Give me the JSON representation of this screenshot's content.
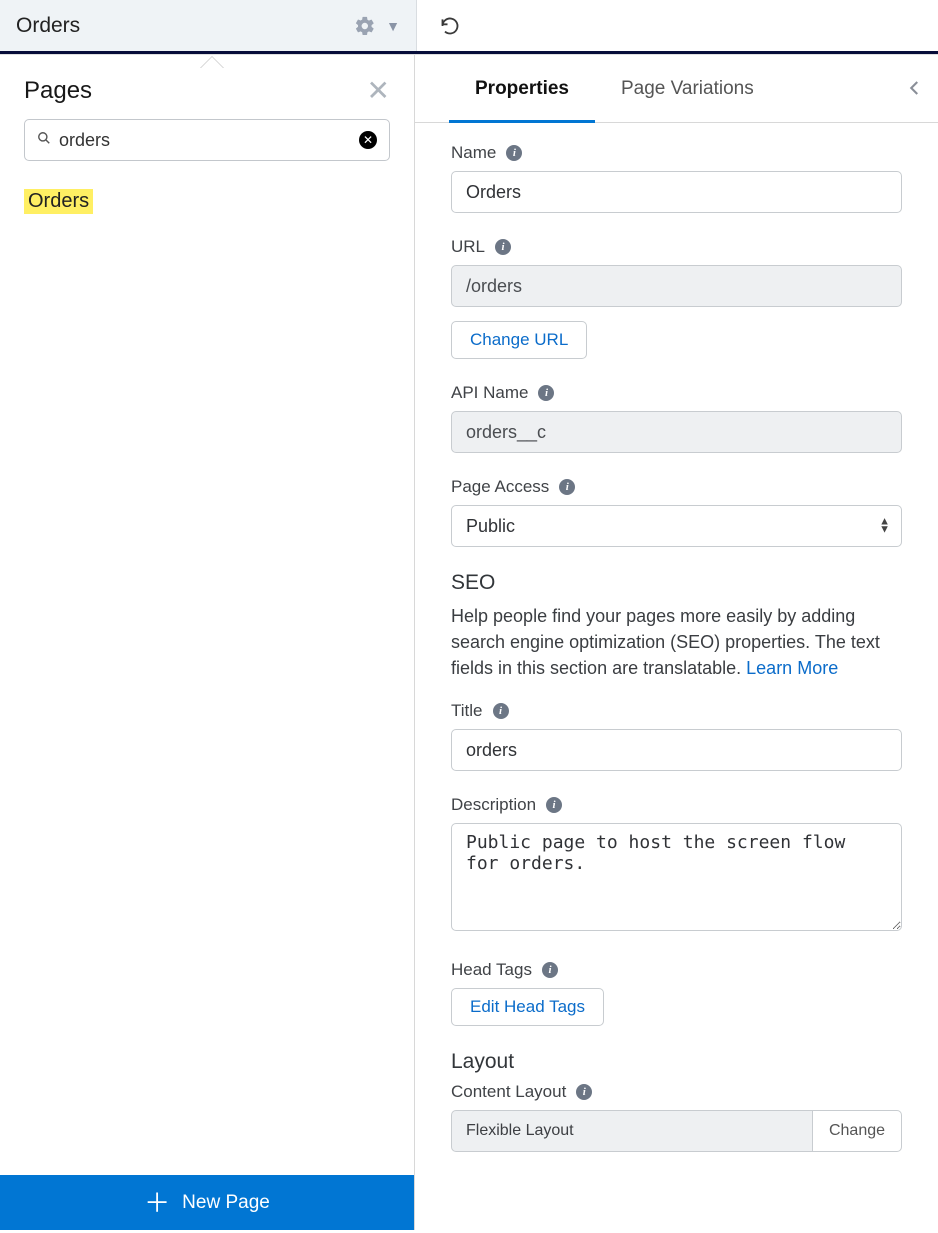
{
  "topbar": {
    "title": "Orders"
  },
  "leftPanel": {
    "title": "Pages",
    "search": {
      "value": "orders"
    },
    "results": [
      "Orders"
    ],
    "newPageLabel": "New Page"
  },
  "rightPanel": {
    "tabs": [
      {
        "label": "Properties",
        "active": true
      },
      {
        "label": "Page Variations",
        "active": false
      }
    ],
    "fields": {
      "name": {
        "label": "Name",
        "value": "Orders"
      },
      "url": {
        "label": "URL",
        "value": "/orders",
        "changeBtn": "Change URL"
      },
      "apiName": {
        "label": "API Name",
        "value": "orders__c"
      },
      "pageAccess": {
        "label": "Page Access",
        "value": "Public"
      }
    },
    "seo": {
      "heading": "SEO",
      "helpText": "Help people find your pages more easily by adding search engine optimization (SEO) properties. The text fields in this section are translatable. ",
      "learnMore": "Learn More",
      "title": {
        "label": "Title",
        "value": "orders"
      },
      "description": {
        "label": "Description",
        "value": "Public page to host the screen flow for orders."
      },
      "headTags": {
        "label": "Head Tags",
        "button": "Edit Head Tags"
      }
    },
    "layout": {
      "heading": "Layout",
      "contentLayout": {
        "label": "Content Layout",
        "value": "Flexible Layout",
        "changeBtn": "Change"
      }
    }
  }
}
